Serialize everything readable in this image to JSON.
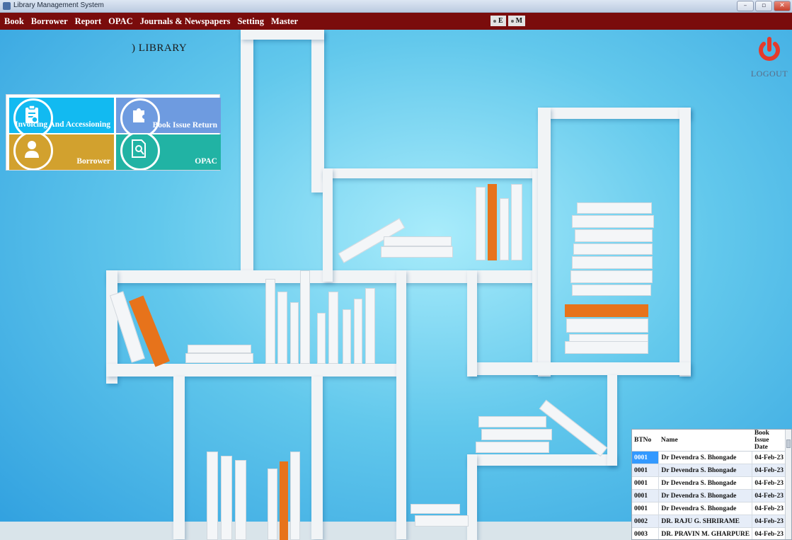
{
  "window": {
    "title": "Library Management System",
    "buttons": [
      "–",
      "▫",
      "✕"
    ]
  },
  "menubar": {
    "items": [
      "Book",
      "Borrower",
      "Report",
      "OPAC",
      "Journals & Newspapers",
      "Setting",
      "Master"
    ],
    "languages": [
      "E",
      "M"
    ]
  },
  "header": {
    "library_title": ") LIBRARY"
  },
  "logout": {
    "label": "LOGOUT",
    "icon": "power-icon",
    "color": "#e53b2c"
  },
  "tiles": [
    {
      "label": "Invoicing And Accessioning",
      "icon": "clipboard-icon",
      "color": "#12baf1"
    },
    {
      "label": "Book Issue Return",
      "icon": "puzzle-icon",
      "color": "#6e9be0"
    },
    {
      "label": "Borrower",
      "icon": "user-icon",
      "color": "#d2a12e"
    },
    {
      "label": "OPAC",
      "icon": "document-search-icon",
      "color": "#21b3a4"
    }
  ],
  "issue_table": {
    "columns": [
      "BTNo",
      "Name",
      "Book Issue Date"
    ],
    "rows": [
      [
        "0001",
        "Dr Devendra S. Bhongade",
        "04-Feb-23"
      ],
      [
        "0001",
        "Dr Devendra S. Bhongade",
        "04-Feb-23"
      ],
      [
        "0001",
        "Dr Devendra S. Bhongade",
        "04-Feb-23"
      ],
      [
        "0001",
        "Dr Devendra S. Bhongade",
        "04-Feb-23"
      ],
      [
        "0001",
        "Dr Devendra S. Bhongade",
        "04-Feb-23"
      ],
      [
        "0002",
        "DR. RAJU G. SHRIRAME",
        "04-Feb-23"
      ],
      [
        "0003",
        "DR. PRAVIN M. GHARPURE",
        "04-Feb-23"
      ]
    ]
  }
}
